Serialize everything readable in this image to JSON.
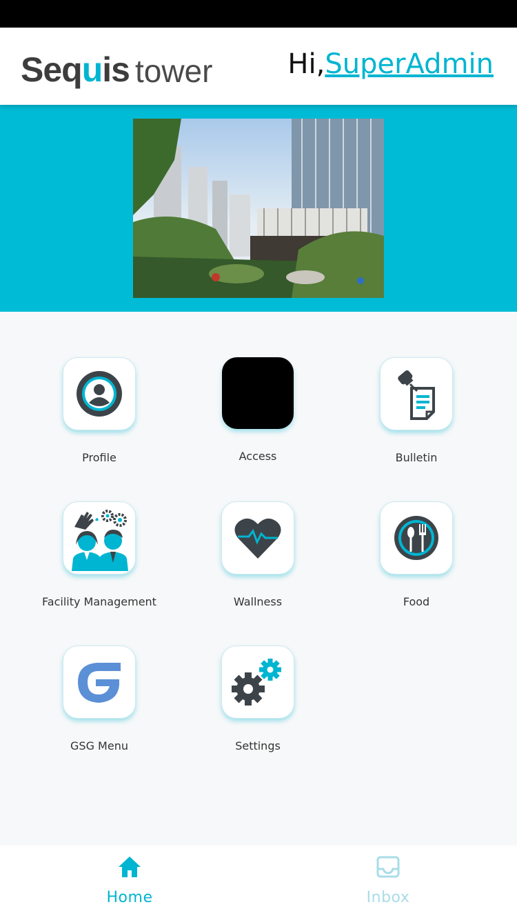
{
  "header": {
    "logo_text_main": "Sequis",
    "logo_text_sub": "tower",
    "greeting_prefix": "Hi,",
    "username": "SuperAdmin"
  },
  "menu": [
    {
      "label": "Profile",
      "icon": "profile-icon"
    },
    {
      "label": "Access",
      "icon": "access-icon"
    },
    {
      "label": "Bulletin",
      "icon": "bulletin-icon"
    },
    {
      "label": "Facility Management",
      "icon": "facility-management-icon"
    },
    {
      "label": "Wallness",
      "icon": "heart-pulse-icon"
    },
    {
      "label": "Food",
      "icon": "food-icon"
    },
    {
      "label": "GSG Menu",
      "icon": "gsg-logo-icon"
    },
    {
      "label": "Settings",
      "icon": "gears-icon"
    }
  ],
  "tabs": [
    {
      "label": "Home",
      "icon": "home-icon",
      "active": true
    },
    {
      "label": "Inbox",
      "icon": "inbox-icon",
      "active": false
    }
  ],
  "colors": {
    "accent": "#00b5d1",
    "banner": "#00bbd6",
    "icon_dark": "#3d4449",
    "gsg_blue": "#5b8fd6"
  }
}
